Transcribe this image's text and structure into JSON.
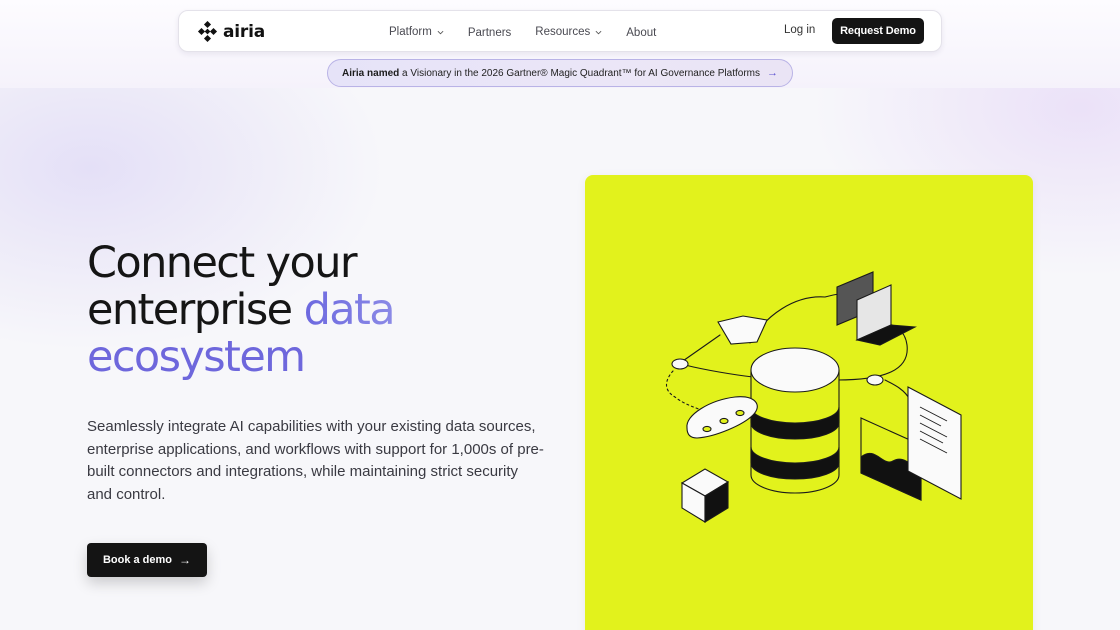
{
  "brand": {
    "name": "airia"
  },
  "nav": {
    "items": [
      {
        "label": "Platform",
        "has_dropdown": true
      },
      {
        "label": "Partners",
        "has_dropdown": false
      },
      {
        "label": "Resources",
        "has_dropdown": true
      },
      {
        "label": "About",
        "has_dropdown": false
      }
    ],
    "login_label": "Log in",
    "request_demo_label": "Request Demo"
  },
  "announcement": {
    "lead": "Airia named",
    "strong": "a Visionary",
    "rest": "in the 2026 Gartner® Magic Quadrant™ for AI Governance Platforms",
    "arrow_icon": "arrow-right-icon"
  },
  "hero": {
    "headline_line1": "Connect your",
    "headline_line2_plain": "enterprise",
    "headline_line2_accent": "data",
    "headline_line3_accent": "ecosystem",
    "description": "Seamlessly integrate AI capabilities with your existing data sources, enterprise applications, and workflows with support for 1,000s of pre-built connectors and integrations, while maintaining strict security and control.",
    "cta_label": "Book a demo"
  },
  "colors": {
    "accent": "#6e67dc",
    "panel": "#e2f21c",
    "button": "#141414"
  }
}
